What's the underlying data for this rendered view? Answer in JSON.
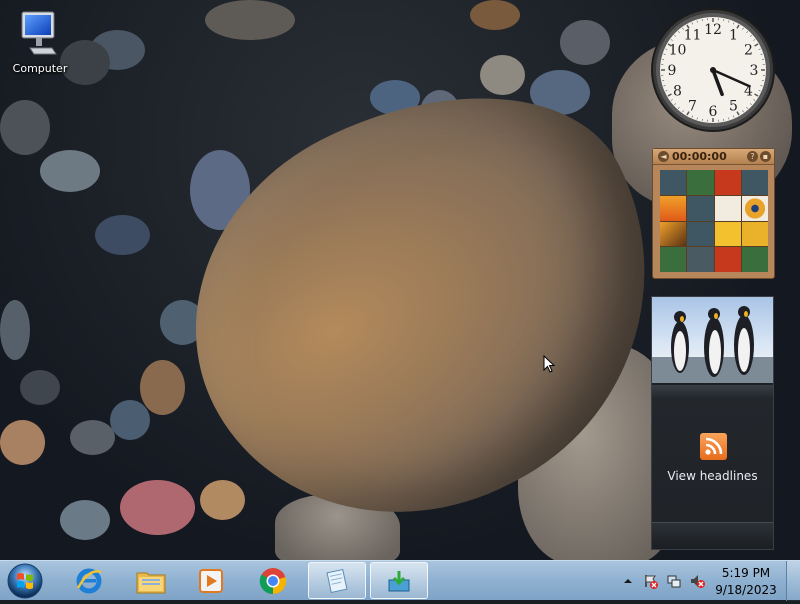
{
  "desktop": {
    "icons": [
      {
        "label": "Computer",
        "icon": "computer-icon"
      }
    ]
  },
  "gadgets": {
    "clock": {
      "hour": 5,
      "minute": 19,
      "numerals": [
        "12",
        "1",
        "2",
        "3",
        "4",
        "5",
        "6",
        "7",
        "8",
        "9",
        "10",
        "11"
      ]
    },
    "puzzle": {
      "timer": "00:00:00"
    },
    "feed": {
      "label": "View headlines",
      "icon": "rss-icon"
    }
  },
  "taskbar": {
    "start": {
      "icon": "windows-start-icon"
    },
    "pinned": [
      {
        "name": "internet-explorer",
        "icon": "internet-explorer-icon"
      },
      {
        "name": "file-explorer",
        "icon": "folder-icon"
      },
      {
        "name": "media-player",
        "icon": "media-player-icon"
      },
      {
        "name": "chrome",
        "icon": "chrome-icon"
      },
      {
        "name": "notepad",
        "icon": "notepad-icon",
        "active": true
      },
      {
        "name": "installer",
        "icon": "installer-icon",
        "active": true
      }
    ],
    "tray": {
      "time": "5:19 PM",
      "date": "9/18/2023",
      "icons": [
        "show-hidden-icons-icon",
        "action-center-icon",
        "network-icon",
        "volume-muted-icon"
      ]
    }
  },
  "colors": {
    "taskbar": "#8fb1d1",
    "rock": "#9a7a58",
    "rss": "#f08a30"
  }
}
